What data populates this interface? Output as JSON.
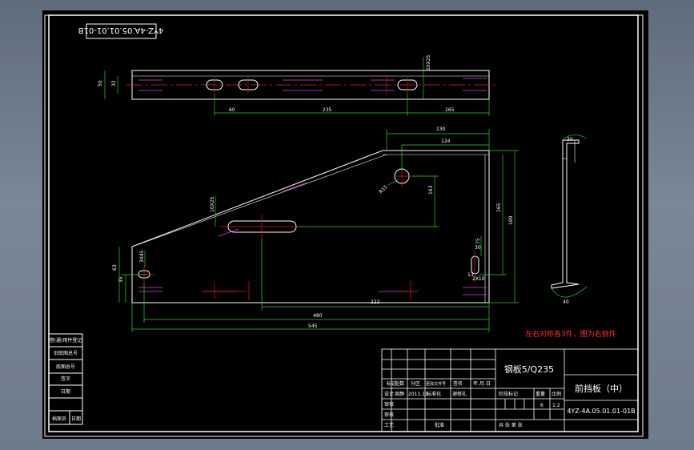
{
  "drawing": {
    "number_box": "4YZ-4A.05.01.01-01B",
    "bottom_number": "4YZ-4A.05.01.01-01B",
    "note": "左右对称各3件，图为右侧件",
    "material": "钢板5/Q235",
    "part_name": "前挡板（中）",
    "designer": "周静",
    "date": "2011.11",
    "standardizer": "谢修礼",
    "scale": "1:2",
    "quantity": "6",
    "sheets_label": "共  张  第  张"
  },
  "title_block": {
    "header_row": [
      "标记",
      "处数",
      "分区",
      "更改文件号",
      "签名",
      "年.月.日"
    ],
    "design_label": "设计",
    "standard_label": "标准化",
    "check_label": "审核",
    "craft_label": "工艺",
    "approve_label": "批准",
    "stage_label": "阶段标记",
    "weight_label": "重量",
    "scale_label": "比例"
  },
  "side_table": [
    "借(通)用件登记",
    "旧底图总号",
    "底图总号",
    "签字",
    "日期",
    "档案员",
    "日期"
  ],
  "dimensions": {
    "top_view": [
      "50",
      "32",
      "60",
      "235",
      "165",
      "10X25"
    ],
    "front_view": [
      "130",
      "124",
      "163",
      "165",
      "189",
      "R15",
      "10X25",
      "3X45",
      "75",
      "13",
      "30",
      "2X10",
      "222",
      "480",
      "545",
      "63",
      "35"
    ],
    "side_view": [
      "30",
      "40"
    ]
  }
}
